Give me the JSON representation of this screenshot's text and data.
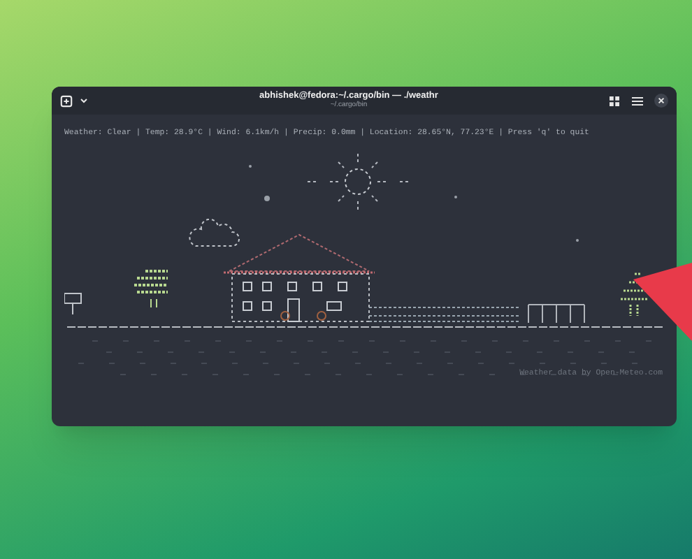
{
  "window": {
    "title": "abhishek@fedora:~/.cargo/bin — ./weathr",
    "subtitle": "~/.cargo/bin"
  },
  "status_line": "Weather: Clear | Temp: 28.9°C | Wind: 6.1km/h | Precip: 0.0mm | Location: 28.65°N, 77.23°E | Press 'q' to quit",
  "footer": "Weather data by Open-Meteo.com"
}
